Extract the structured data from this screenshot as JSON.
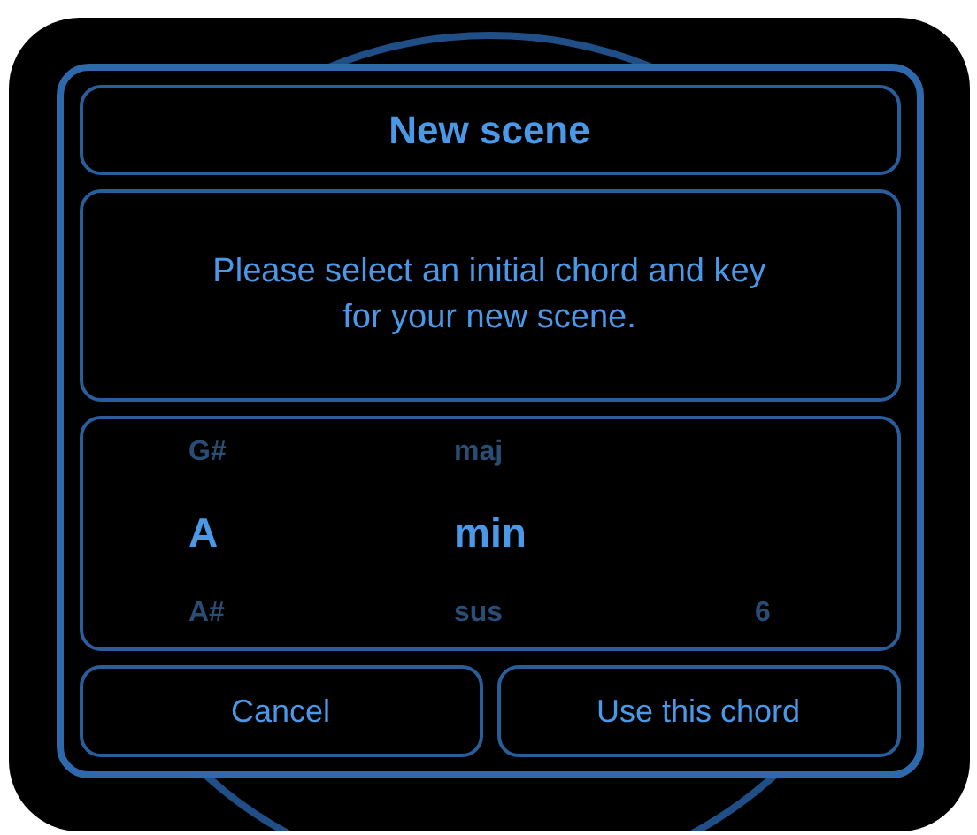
{
  "dialog": {
    "title": "New scene",
    "message": "Please select an initial chord and key for your new scene.",
    "picker": {
      "columns": [
        {
          "above": "G#",
          "current": "A",
          "below": "A#"
        },
        {
          "above": "maj",
          "current": "min",
          "below": "sus"
        },
        {
          "below": "6"
        }
      ]
    },
    "buttons": [
      "Cancel",
      "Use this chord"
    ]
  }
}
